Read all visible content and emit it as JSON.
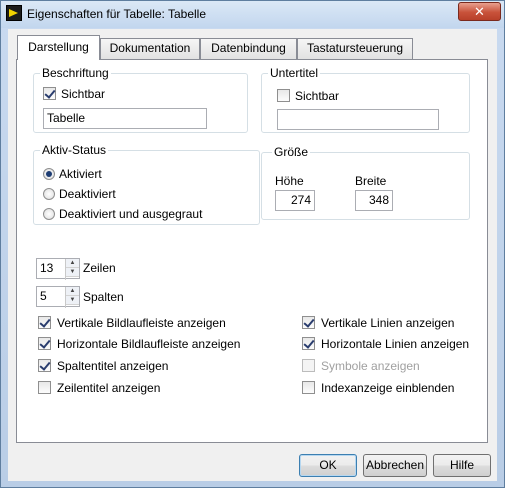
{
  "window": {
    "title": "Eigenschaften für Tabelle: Tabelle",
    "close_label": "✕"
  },
  "tabs": [
    {
      "label": "Darstellung",
      "active": true
    },
    {
      "label": "Dokumentation",
      "active": false
    },
    {
      "label": "Datenbindung",
      "active": false
    },
    {
      "label": "Tastatursteuerung",
      "active": false
    }
  ],
  "beschriftung": {
    "heading": "Beschriftung",
    "visible_label": "Sichtbar",
    "visible_checked": true,
    "value": "Tabelle"
  },
  "untertitel": {
    "heading": "Untertitel",
    "visible_label": "Sichtbar",
    "visible_checked": false,
    "value": ""
  },
  "aktiv_status": {
    "heading": "Aktiv-Status",
    "options": [
      "Aktiviert",
      "Deaktiviert",
      "Deaktiviert und ausgegraut"
    ],
    "selected": "Aktiviert"
  },
  "groesse": {
    "heading": "Größe",
    "hoehe_label": "Höhe",
    "hoehe_value": "274",
    "breite_label": "Breite",
    "breite_value": "348"
  },
  "zeilen": {
    "value": "13",
    "label": "Zeilen"
  },
  "spalten": {
    "value": "5",
    "label": "Spalten"
  },
  "options_left": [
    {
      "label": "Vertikale Bildlaufleiste anzeigen",
      "checked": true
    },
    {
      "label": "Horizontale Bildlaufleiste anzeigen",
      "checked": true
    },
    {
      "label": "Spaltentitel anzeigen",
      "checked": true
    },
    {
      "label": "Zeilentitel anzeigen",
      "checked": false
    }
  ],
  "options_right": [
    {
      "label": "Vertikale Linien anzeigen",
      "checked": true,
      "disabled": false
    },
    {
      "label": "Horizontale Linien anzeigen",
      "checked": true,
      "disabled": false
    },
    {
      "label": "Symbole anzeigen",
      "checked": false,
      "disabled": true
    },
    {
      "label": "Indexanzeige einblenden",
      "checked": false,
      "disabled": false
    }
  ],
  "buttons": {
    "ok": "OK",
    "cancel": "Abbrechen",
    "help": "Hilfe"
  },
  "icons": {
    "app": "labview-icon",
    "close": "close-icon"
  }
}
